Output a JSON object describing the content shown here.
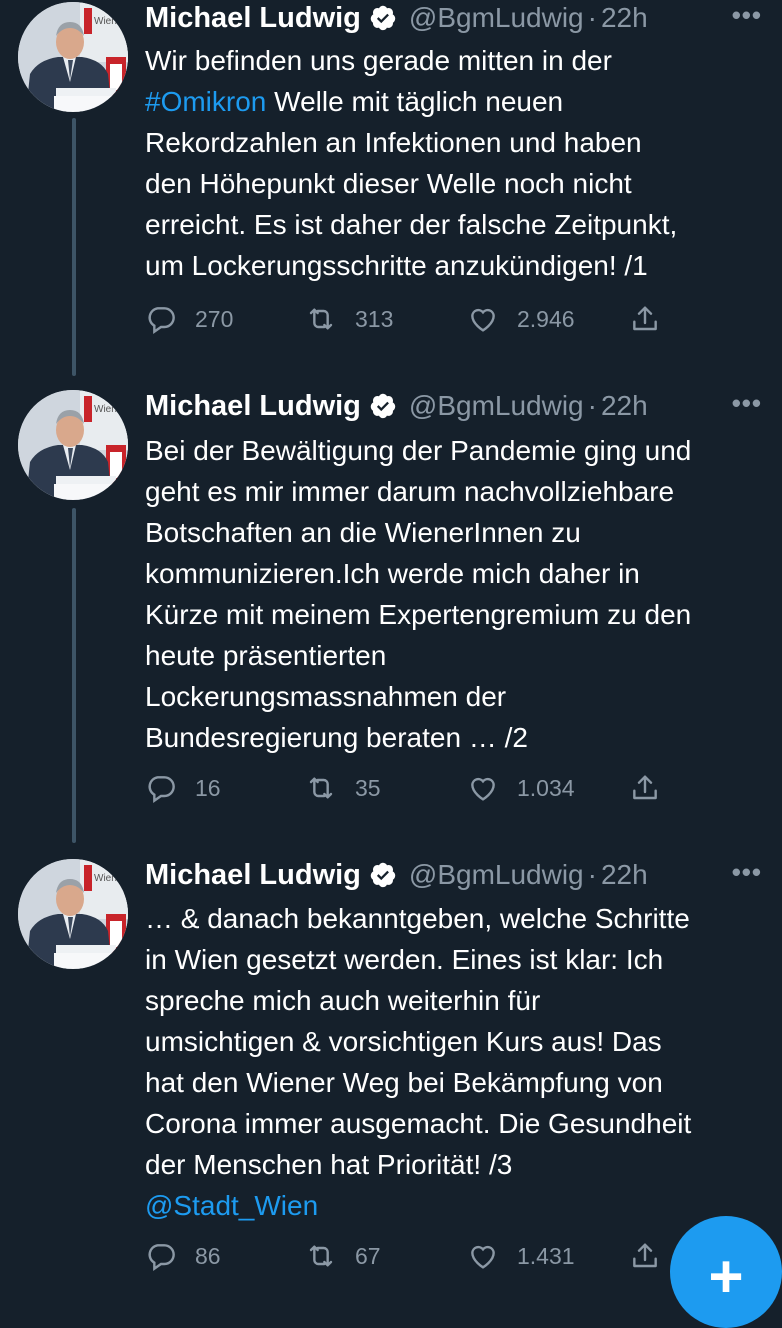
{
  "tweets": [
    {
      "author": "Michael Ludwig",
      "handle": "@BgmLudwig",
      "separator": "·",
      "time": "22h",
      "more": "•••",
      "lines": [
        [
          {
            "t": "Wir befinden uns gerade mitten in der"
          }
        ],
        [
          {
            "t": "#Omikron",
            "link": true
          },
          {
            "t": " Welle mit täglich neuen"
          }
        ],
        [
          {
            "t": "Rekordzahlen an Infektionen und haben"
          }
        ],
        [
          {
            "t": "den Höhepunkt dieser Welle noch nicht"
          }
        ],
        [
          {
            "t": "erreicht. Es ist daher der falsche Zeitpunkt,"
          }
        ],
        [
          {
            "t": "um Lockerungsschritte anzukündigen! /1"
          }
        ]
      ],
      "replies": "270",
      "retweets": "313",
      "likes": "2.946"
    },
    {
      "author": "Michael Ludwig",
      "handle": "@BgmLudwig",
      "separator": "·",
      "time": "22h",
      "more": "•••",
      "lines": [
        [
          {
            "t": "Bei der Bewältigung der Pandemie ging und"
          }
        ],
        [
          {
            "t": "geht es mir immer darum nachvollziehbare"
          }
        ],
        [
          {
            "t": "Botschaften an die WienerInnen zu"
          }
        ],
        [
          {
            "t": "kommunizieren.Ich werde mich daher in"
          }
        ],
        [
          {
            "t": "Kürze mit meinem Expertengremium zu den"
          }
        ],
        [
          {
            "t": "heute präsentierten"
          }
        ],
        [
          {
            "t": "Lockerungsmassnahmen der"
          }
        ],
        [
          {
            "t": "Bundesregierung beraten … /2"
          }
        ]
      ],
      "replies": "16",
      "retweets": "35",
      "likes": "1.034"
    },
    {
      "author": "Michael Ludwig",
      "handle": "@BgmLudwig",
      "separator": "·",
      "time": "22h",
      "more": "•••",
      "lines": [
        [
          {
            "t": "… & danach bekanntgeben, welche Schritte"
          }
        ],
        [
          {
            "t": "in Wien gesetzt werden. Eines ist klar: Ich"
          }
        ],
        [
          {
            "t": "spreche mich auch weiterhin für"
          }
        ],
        [
          {
            "t": "umsichtigen & vorsichtigen Kurs aus! Das"
          }
        ],
        [
          {
            "t": "hat den Wiener Weg bei Bekämpfung von"
          }
        ],
        [
          {
            "t": "Corona immer ausgemacht. Die Gesundheit"
          }
        ],
        [
          {
            "t": "der Menschen hat Priorität! /3"
          }
        ],
        [
          {
            "t": "@Stadt_Wien",
            "link": true
          }
        ]
      ],
      "replies": "86",
      "retweets": "67",
      "likes": "1.431"
    }
  ],
  "avatar_sign_text": "Wien",
  "compose_button": "+",
  "colors": {
    "background": "#15202b",
    "link": "#1d9bf0",
    "muted": "#8b98a5",
    "verified": "#ffffff",
    "fab": "#1d9bf0"
  }
}
